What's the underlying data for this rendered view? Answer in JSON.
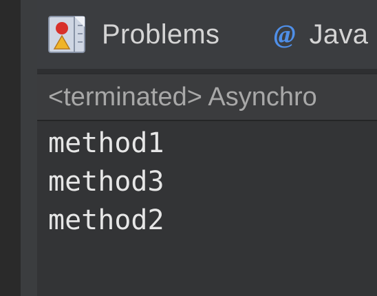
{
  "tabs": [
    {
      "label": "Problems",
      "icon": "problems-icon"
    },
    {
      "label": "Java",
      "icon": "javadoc-icon",
      "glyph": "@"
    }
  ],
  "console": {
    "title": "<terminated> Asynchro",
    "lines": [
      "method1",
      "method3",
      "method2"
    ]
  },
  "colors": {
    "background": "#333436",
    "tab_strip": "#3b3d40",
    "header": "#3b3c3e",
    "text": "#e6e6e6",
    "muted_text": "#a8a8a8",
    "accent_at": "#4f8fe8",
    "problems_icon_red": "#d8302a",
    "problems_icon_yellow": "#f0b429"
  }
}
